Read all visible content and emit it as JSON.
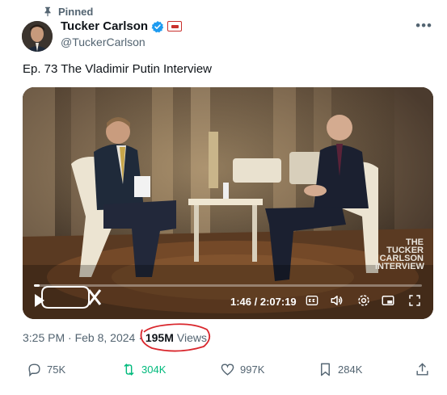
{
  "header": {
    "pinned_label": "Pinned",
    "display_name": "Tucker Carlson",
    "handle": "@TuckerCarlson"
  },
  "tweet": {
    "text": "Ep. 73  The Vladimir Putin Interview"
  },
  "video": {
    "time": "1:46 / 2:07:19",
    "progress_fraction": 0.014,
    "logo_text": "TCN ON X",
    "watermark_lines": [
      "THE",
      "TUCKER",
      "CARLSON",
      "INTERVIEW"
    ]
  },
  "meta": {
    "timestamp": "3:25 PM · Feb 8, 2024 · ",
    "views_count": "195M",
    "views_label": "Views",
    "highlight_color": "#d9262c"
  },
  "actions": {
    "replies": "75K",
    "retweets": "304K",
    "likes": "997K",
    "bookmarks": "284K"
  },
  "colors": {
    "secondary_text": "#536471",
    "retweet_green": "#00ba7c",
    "verified_blue": "#1d9bf0"
  },
  "icons": [
    "pin-icon",
    "verified-icon",
    "affiliate-badge-icon",
    "more-icon",
    "play-icon",
    "closed-captions-icon",
    "volume-icon",
    "settings-icon",
    "miniplayer-icon",
    "fullscreen-icon",
    "reply-icon",
    "retweet-icon",
    "like-icon",
    "bookmark-icon",
    "share-icon"
  ]
}
